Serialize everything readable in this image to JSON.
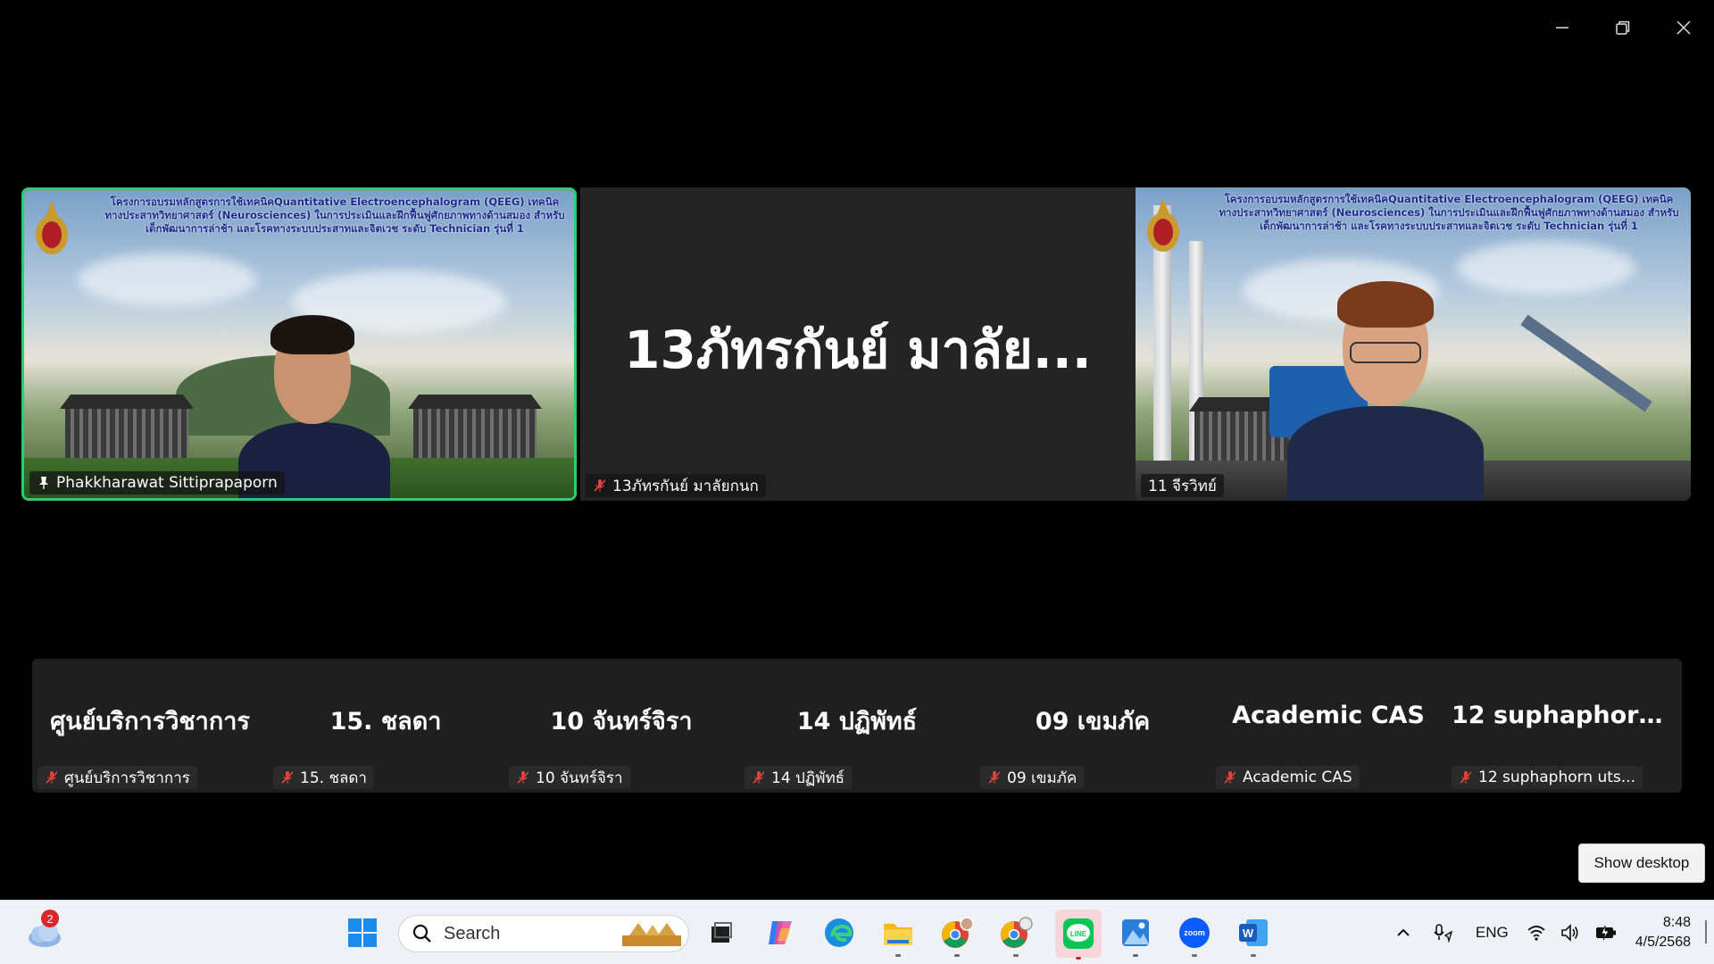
{
  "window": {
    "controls": {
      "minimize": "minimize",
      "restore": "restore",
      "close": "close"
    }
  },
  "main_tiles": [
    {
      "banner": "โครงการอบรมหลักสูตรการใช้เทคนิคQuantitative Electroencephalogram (QEEG) เทคนิคทางประสาทวิทยาศาสตร์ (Neurosciences) ในการประเมินและฝึกฟื้นฟูศักยภาพทางด้านสมอง สำหรับเด็กพัฒนาการล่าช้า และโรคทางระบบประสาทและจิตเวช ระดับ Technician รุ่นที่ 1",
      "name": "Phakkharawat Sittiprapaporn",
      "status_icon": "pin-icon",
      "active_speaker": true
    },
    {
      "display_name": "13ภัทรกันย์ มาลัย...",
      "name": "13ภัทรกันย์ มาลัยกนก",
      "status_icon": "mic-muted-icon",
      "video_off": true
    },
    {
      "banner": "โครงการอบรมหลักสูตรการใช้เทคนิคQuantitative Electroencephalogram (QEEG) เทคนิคทางประสาทวิทยาศาสตร์ (Neurosciences) ในการประเมินและฝึกฟื้นฟูศักยภาพทางด้านสมอง สำหรับเด็กพัฒนาการล่าช้า และโรคทางระบบประสาทและจิตเวช ระดับ Technician รุ่นที่ 1",
      "name": "11 จีรวิทย์",
      "status_icon": "none"
    }
  ],
  "gallery": [
    {
      "display_name": "ศูนย์บริการวิชาการ",
      "name": "ศูนย์บริการวิชาการ",
      "status_icon": "mic-muted-icon"
    },
    {
      "display_name": "15. ชลดา",
      "name": "15. ชลดา",
      "status_icon": "mic-muted-icon"
    },
    {
      "display_name": "10 จันทร์จิรา",
      "name": "10 จันทร์จิรา",
      "status_icon": "mic-muted-icon"
    },
    {
      "display_name": "14 ปฏิพัทธ์",
      "name": "14 ปฏิพัทธ์",
      "status_icon": "mic-muted-icon"
    },
    {
      "display_name": "09 เขมภัค",
      "name": "09 เขมภัค",
      "status_icon": "mic-muted-icon"
    },
    {
      "display_name": "Academic CAS",
      "name": "Academic CAS",
      "status_icon": "mic-muted-icon"
    },
    {
      "display_name": "12  suphaphorn...",
      "name": "12 suphaphorn uts...",
      "status_icon": "mic-muted-icon"
    }
  ],
  "show_desktop_label": "Show desktop",
  "taskbar": {
    "weather_badge": "2",
    "search_placeholder": "Search",
    "apps": [
      {
        "name": "windows-start-icon"
      },
      {
        "name": "task-view-icon"
      },
      {
        "name": "copilot-icon"
      },
      {
        "name": "edge-icon"
      },
      {
        "name": "file-explorer-icon"
      },
      {
        "name": "chrome-profile-1-icon"
      },
      {
        "name": "chrome-profile-2-icon"
      },
      {
        "name": "line-icon",
        "active": true
      },
      {
        "name": "photos-icon"
      },
      {
        "name": "zoom-icon"
      },
      {
        "name": "word-icon"
      }
    ],
    "tray": {
      "language": "ENG",
      "time": "8:48",
      "date": "4/5/2568"
    }
  },
  "colors": {
    "active_speaker_border": "#2ecc71",
    "muted_icon": "#e0443e",
    "line_green": "#06c755",
    "zoom_blue": "#0b5cff"
  }
}
